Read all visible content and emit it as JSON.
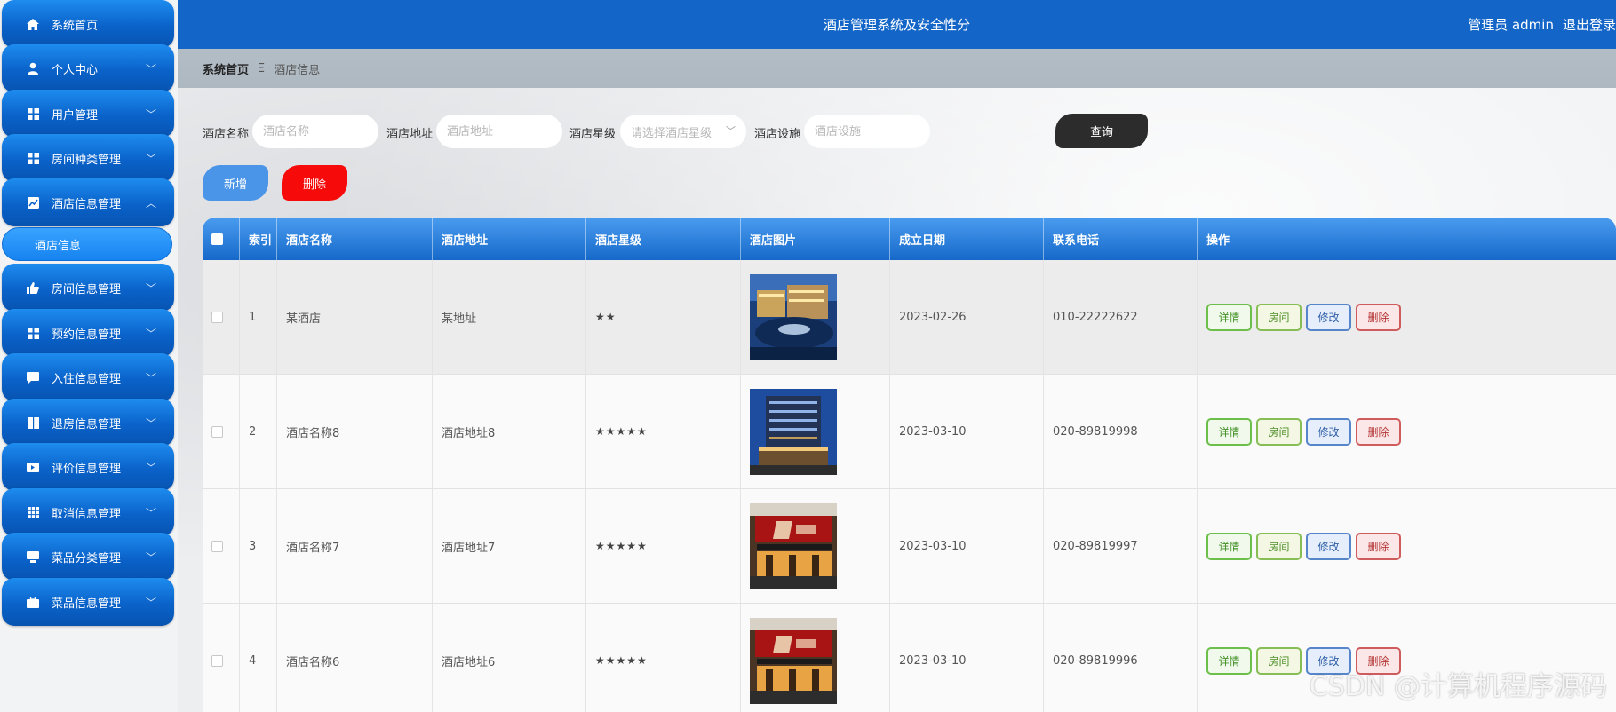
{
  "header": {
    "system_title": "酒店管理系统及安全性分",
    "user_label": "管理员 admin",
    "logout_label": "退出登录"
  },
  "breadcrumb": {
    "home": "系统首页",
    "separator": "Ξ",
    "current": "酒店信息"
  },
  "sidebar": {
    "items": [
      {
        "label": "系统首页",
        "icon": "home-icon",
        "chevron": ""
      },
      {
        "label": "个人中心",
        "icon": "user-icon",
        "chevron": "﹀"
      },
      {
        "label": "用户管理",
        "icon": "grid-icon",
        "chevron": "﹀"
      },
      {
        "label": "房间种类管理",
        "icon": "grid-icon",
        "chevron": "﹀"
      },
      {
        "label": "酒店信息管理",
        "icon": "chart-icon",
        "chevron": "︿"
      },
      {
        "label": "房间信息管理",
        "icon": "thumbs-up-icon",
        "chevron": "﹀"
      },
      {
        "label": "预约信息管理",
        "icon": "grid-icon",
        "chevron": "﹀"
      },
      {
        "label": "入住信息管理",
        "icon": "message-icon",
        "chevron": "﹀"
      },
      {
        "label": "退房信息管理",
        "icon": "book-icon",
        "chevron": "﹀"
      },
      {
        "label": "评价信息管理",
        "icon": "video-icon",
        "chevron": "﹀"
      },
      {
        "label": "取消信息管理",
        "icon": "table-grid-icon",
        "chevron": "﹀"
      },
      {
        "label": "菜品分类管理",
        "icon": "monitor-icon",
        "chevron": "﹀"
      },
      {
        "label": "菜品信息管理",
        "icon": "briefcase-icon",
        "chevron": "﹀"
      }
    ],
    "active_sub_item": "酒店信息"
  },
  "filters": {
    "name": {
      "label": "酒店名称",
      "placeholder": "酒店名称",
      "value": ""
    },
    "address": {
      "label": "酒店地址",
      "placeholder": "酒店地址",
      "value": ""
    },
    "star": {
      "label": "酒店星级",
      "placeholder": "请选择酒店星级"
    },
    "facility": {
      "label": "酒店设施",
      "placeholder": "酒店设施",
      "value": ""
    },
    "search_label": "查询"
  },
  "actions": {
    "add_label": "新增",
    "delete_label": "删除"
  },
  "table": {
    "columns": [
      "索引",
      "酒店名称",
      "酒店地址",
      "酒店星级",
      "酒店图片",
      "成立日期",
      "联系电话",
      "操作"
    ],
    "rows": [
      {
        "index": "1",
        "name": "某酒店",
        "address": "某地址",
        "stars": "★★",
        "image": "hotel-night-photo",
        "date": "2023-02-26",
        "phone": "010-22222622"
      },
      {
        "index": "2",
        "name": "酒店名称8",
        "address": "酒店地址8",
        "stars": "★★★★★",
        "image": "hotel-tower-photo",
        "date": "2023-03-10",
        "phone": "020-89819998"
      },
      {
        "index": "3",
        "name": "酒店名称7",
        "address": "酒店地址7",
        "stars": "★★★★★",
        "image": "hotel-sign-photo",
        "date": "2023-03-10",
        "phone": "020-89819997"
      },
      {
        "index": "4",
        "name": "酒店名称6",
        "address": "酒店地址6",
        "stars": "★★★★★",
        "image": "hotel-sign-photo",
        "date": "2023-03-10",
        "phone": "020-89819996"
      }
    ],
    "row_actions": {
      "detail": "详情",
      "room": "房间",
      "edit": "修改",
      "delete": "删除"
    }
  },
  "watermark": "CSDN @计算机程序源码",
  "colors": {
    "sidebar_blue": "#0a62c9",
    "header_blue": "#1366c8",
    "search_button": "#2c2c2c",
    "add_button": "#4a95e8",
    "delete_button": "#f60a0a"
  }
}
